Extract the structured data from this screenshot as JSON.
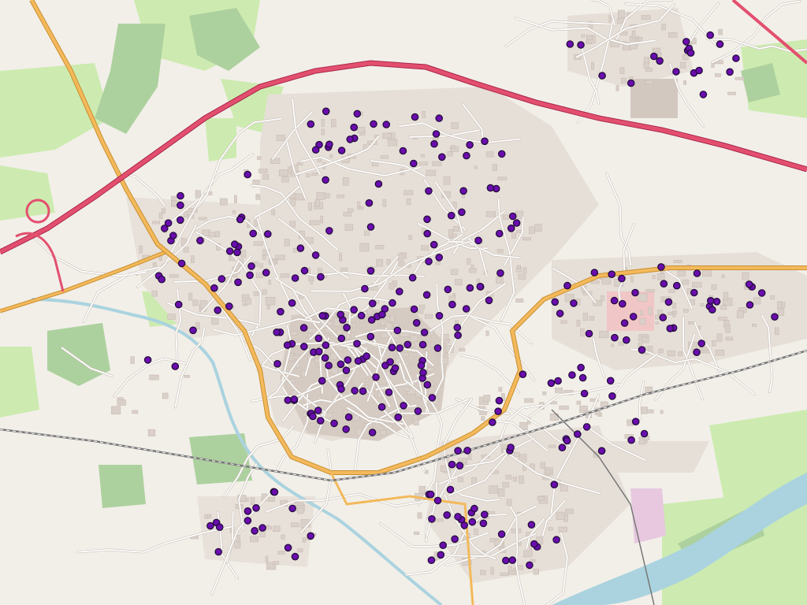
{
  "map": {
    "theme": "openstreetmap-standard",
    "colors": {
      "land": "#f2efe9",
      "building": "#d9d0c9",
      "park": "#cdebb0",
      "forest": "#add19e",
      "water": "#aad3df",
      "motorway": "#e34f6f",
      "primary": "#f3b95b",
      "railway": "#777777",
      "poi_fill": "#6a0dad",
      "poi_stroke": "#1e0b35"
    },
    "poi_marker_icon": "purple-circle-marker-icon",
    "poi_count_shown": 300
  }
}
